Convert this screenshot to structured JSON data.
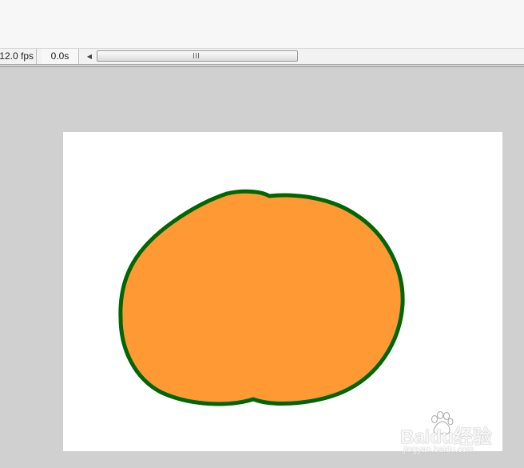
{
  "timeline": {
    "fps": "12.0 fps",
    "elapsed": "0.0s"
  },
  "stage": {
    "background": "#ffffff",
    "shape": {
      "fill": "#ff9933",
      "stroke": "#006600"
    }
  },
  "watermark": {
    "brand": "Bai",
    "brand_tail": "经验",
    "url": "jingyan.baidu.com"
  },
  "colors": {
    "workspace": "#d0d0d0",
    "toolbar": "#f2f2f2"
  }
}
